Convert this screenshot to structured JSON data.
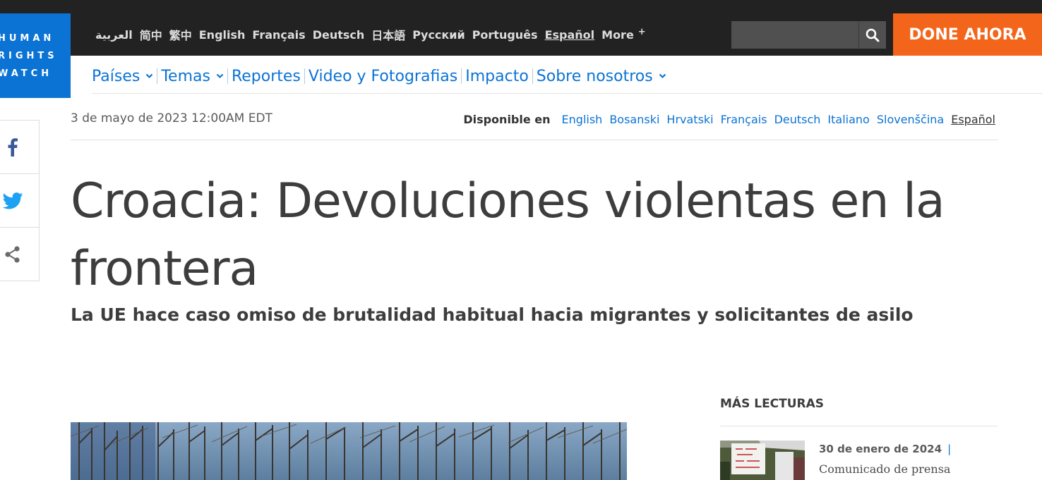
{
  "header": {
    "logo_lines": [
      "HUMAN",
      "RIGHTS",
      "WATCH"
    ],
    "languages": [
      {
        "label": "العربية",
        "current": false
      },
      {
        "label": "简中",
        "current": false
      },
      {
        "label": "繁中",
        "current": false
      },
      {
        "label": "English",
        "current": false
      },
      {
        "label": "Français",
        "current": false
      },
      {
        "label": "Deutsch",
        "current": false
      },
      {
        "label": "日本語",
        "current": false
      },
      {
        "label": "Русский",
        "current": false
      },
      {
        "label": "Português",
        "current": false
      },
      {
        "label": "Español",
        "current": true
      }
    ],
    "more_label": "More",
    "more_plus": "+",
    "search": {
      "placeholder": "",
      "icon": "search-icon"
    },
    "donate_label": "DONE AHORA"
  },
  "nav": {
    "items": [
      {
        "label": "Países",
        "dropdown": true
      },
      {
        "label": "Temas",
        "dropdown": true
      },
      {
        "label": "Reportes",
        "dropdown": false
      },
      {
        "label": "Video y Fotografias",
        "dropdown": false
      },
      {
        "label": "Impacto",
        "dropdown": false
      },
      {
        "label": "Sobre nosotros",
        "dropdown": true
      }
    ]
  },
  "share": [
    "facebook-icon",
    "twitter-icon",
    "share-icon"
  ],
  "article": {
    "date": "3 de mayo de 2023 12:00AM EDT",
    "available_label": "Disponible en",
    "available_languages": [
      {
        "label": "English",
        "current": false
      },
      {
        "label": "Bosanski",
        "current": false
      },
      {
        "label": "Hrvatski",
        "current": false
      },
      {
        "label": "Français",
        "current": false
      },
      {
        "label": "Deutsch",
        "current": false
      },
      {
        "label": "Italiano",
        "current": false
      },
      {
        "label": "Slovenščina",
        "current": false
      },
      {
        "label": "Español",
        "current": true
      }
    ],
    "title": "Croacia: Devoluciones violentas en la frontera",
    "subtitle": "La UE hace caso omiso de brutalidad habitual hacia migrantes y solicitantes de asilo"
  },
  "more_reads": {
    "heading": "MÁS LECTURAS",
    "items": [
      {
        "date": "30 de enero de 2024",
        "separator": "|",
        "type": "Comunicado de prensa"
      }
    ]
  },
  "colors": {
    "brand_blue": "#0b73d4",
    "header_dark": "#222222",
    "donate_orange": "#f2651b"
  }
}
